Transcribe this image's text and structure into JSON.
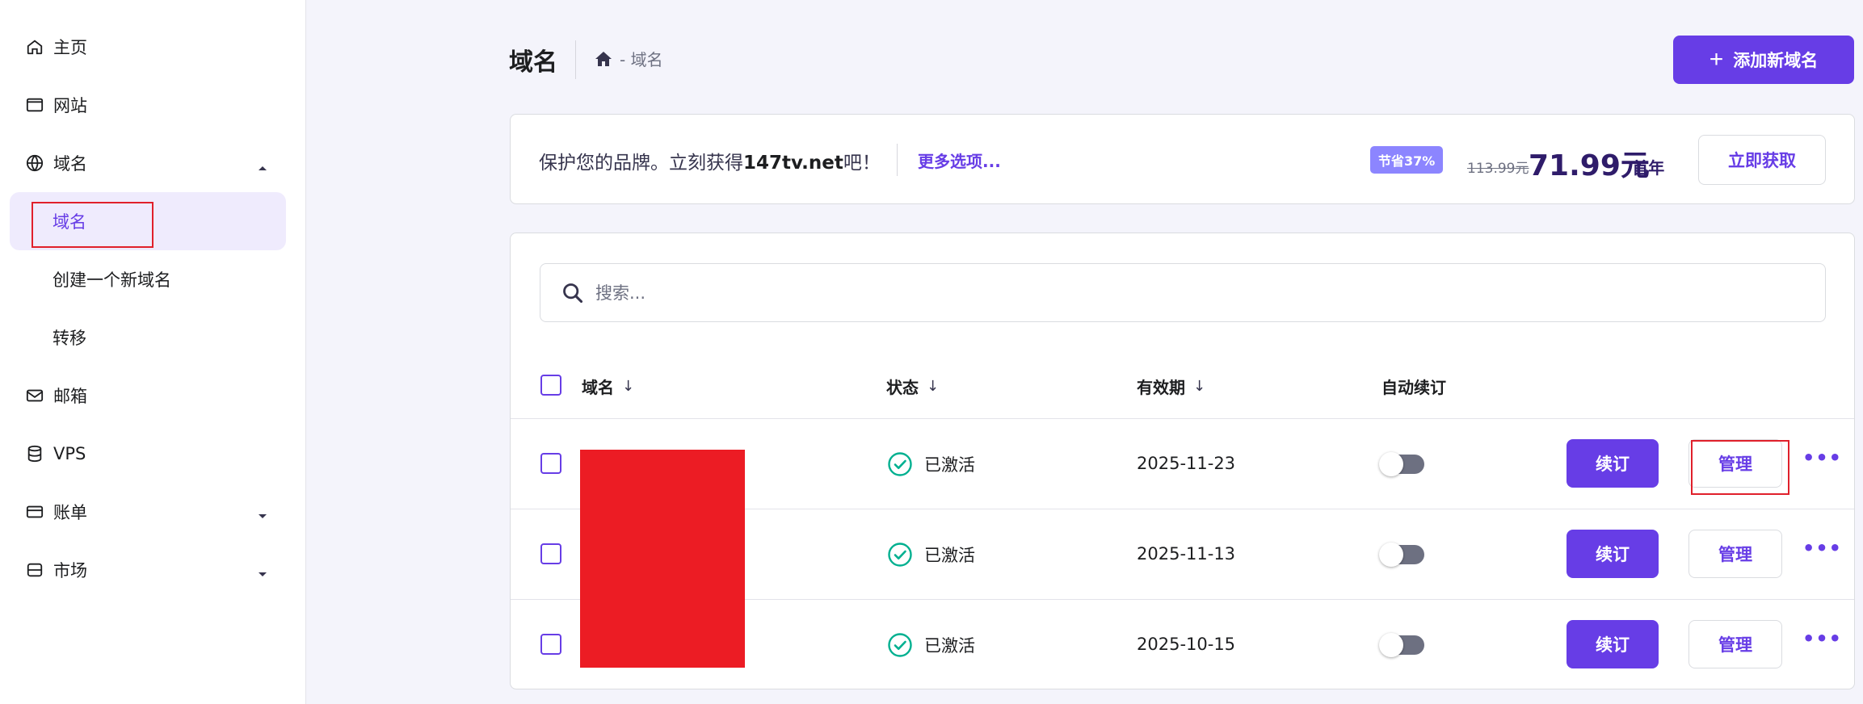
{
  "sidebar": {
    "items": [
      {
        "label": "主页",
        "icon": "home-icon"
      },
      {
        "label": "网站",
        "icon": "browser-window-icon"
      },
      {
        "label": "域名",
        "icon": "globe-icon",
        "expanded": true
      },
      {
        "label": "域名",
        "sub": true,
        "active": true
      },
      {
        "label": "创建一个新域名",
        "sub": true
      },
      {
        "label": "转移",
        "sub": true
      },
      {
        "label": "邮箱",
        "icon": "mail-icon"
      },
      {
        "label": "VPS",
        "icon": "database-icon"
      },
      {
        "label": "账单",
        "icon": "credit-card-icon"
      },
      {
        "label": "市场",
        "icon": "store-icon"
      }
    ]
  },
  "header": {
    "title": "域名",
    "breadcrumb": "- 域名",
    "add_button": "添加新域名"
  },
  "promo": {
    "text_before": "保护您的品牌。立刻获得",
    "domain": "147tv.net",
    "text_after": "吧！",
    "more_link": "更多选项...",
    "badge": "节省37%",
    "old_price": "113.99元",
    "new_price": "71.99元",
    "period": "/首年",
    "cta": "立即获取"
  },
  "search": {
    "placeholder": "搜索..."
  },
  "table": {
    "columns": [
      "域名",
      "状态",
      "有效期",
      "自动续订"
    ],
    "rows": [
      {
        "status": "已激活",
        "expiry": "2025-11-23",
        "auto_renew": false,
        "renew_label": "续订",
        "manage_label": "管理"
      },
      {
        "status": "已激活",
        "expiry": "2025-11-13",
        "auto_renew": false,
        "renew_label": "续订",
        "manage_label": "管理"
      },
      {
        "status": "已激活",
        "expiry": "2025-10-15",
        "auto_renew": false,
        "renew_label": "续订",
        "manage_label": "管理"
      }
    ]
  },
  "colors": {
    "accent": "#673de6",
    "badge": "#8c85ff",
    "success": "#00b090",
    "redaction": "#ec1c24",
    "highlight_box": "#e0202b"
  }
}
